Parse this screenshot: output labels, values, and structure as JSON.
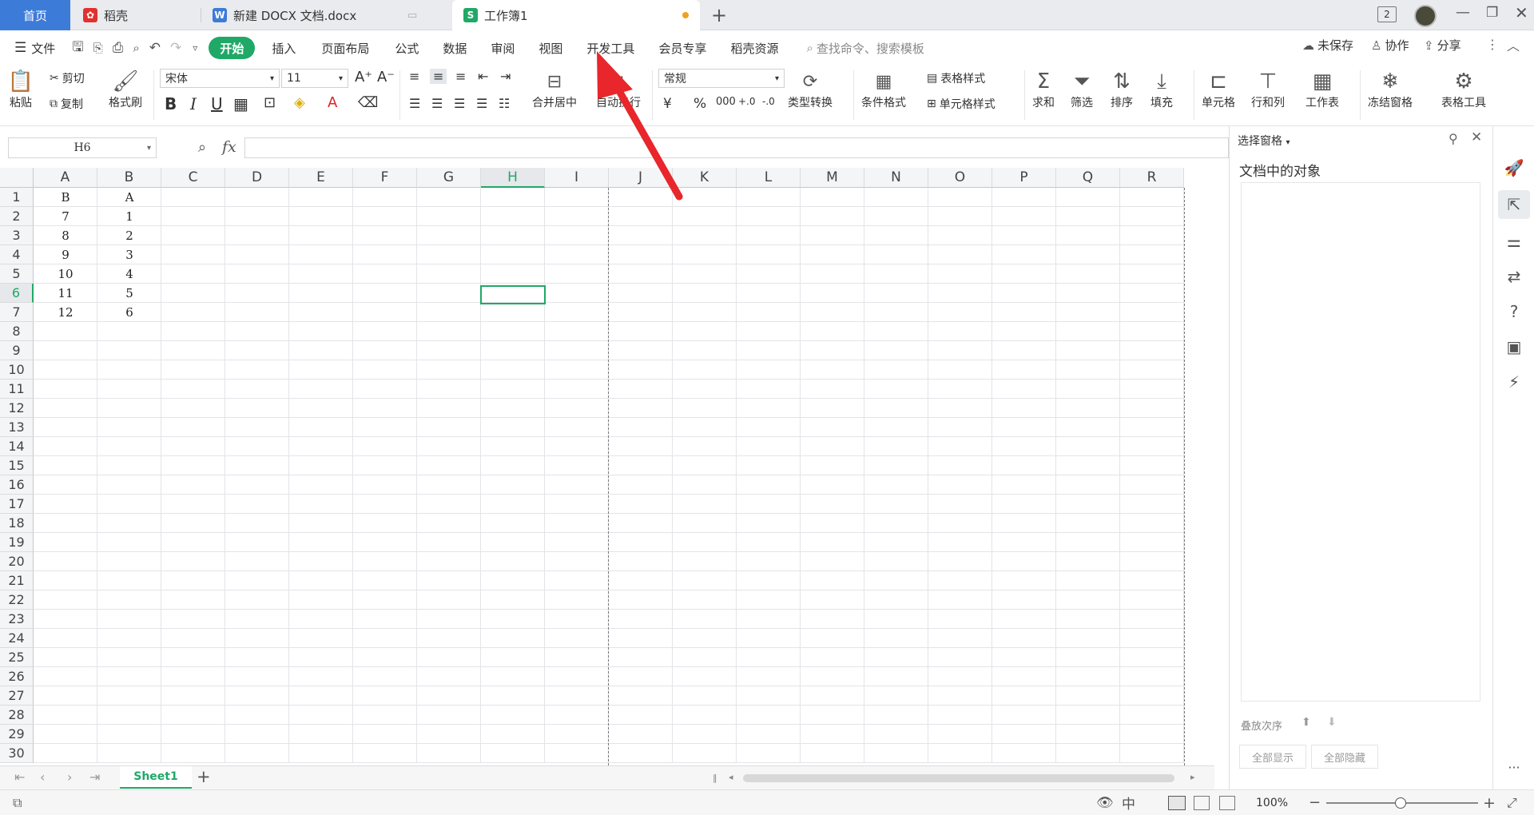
{
  "tabs": {
    "home": "首页",
    "daoke": "稻壳",
    "doc": "新建 DOCX 文档.docx",
    "book": "工作簿1",
    "badge": "2"
  },
  "menu": {
    "file": "文件",
    "items": [
      "开始",
      "插入",
      "页面布局",
      "公式",
      "数据",
      "审阅",
      "视图",
      "开发工具",
      "会员专享",
      "稻壳资源"
    ],
    "search_placeholder": "查找命令、搜索模板",
    "unsaved": "未保存",
    "collab": "协作",
    "share": "分享"
  },
  "ribbon": {
    "paste": "粘贴",
    "cut": "剪切",
    "copy": "复制",
    "format_painter": "格式刷",
    "font_name": "宋体",
    "font_size": "11",
    "merge_center": "合并居中",
    "wrap": "自动换行",
    "number_format": "常规",
    "type_convert": "类型转换",
    "cond_format": "条件格式",
    "table_style": "表格样式",
    "cell_style": "单元格样式",
    "sum": "求和",
    "filter": "筛选",
    "sort": "排序",
    "fill": "填充",
    "cell": "单元格",
    "row_col": "行和列",
    "worksheet": "工作表",
    "freeze": "冻结窗格",
    "table_tools": "表格工具",
    "bold": "B",
    "italic": "I",
    "underline": "U"
  },
  "formula": {
    "name_box": "H6",
    "fx": "fx"
  },
  "grid": {
    "columns": [
      "A",
      "B",
      "C",
      "D",
      "E",
      "F",
      "G",
      "H",
      "I",
      "J",
      "K",
      "L",
      "M",
      "N",
      "O",
      "P",
      "Q",
      "R"
    ],
    "active_column": "H",
    "active_row": "6",
    "rows": [
      "1",
      "2",
      "3",
      "4",
      "5",
      "6",
      "7",
      "8",
      "9",
      "10",
      "11",
      "12",
      "13",
      "14",
      "15",
      "16",
      "17",
      "18",
      "19",
      "20",
      "21",
      "22",
      "23",
      "24",
      "25",
      "26",
      "27",
      "28",
      "29",
      "30"
    ],
    "data": [
      [
        "B",
        "A"
      ],
      [
        "7",
        "1"
      ],
      [
        "8",
        "2"
      ],
      [
        "9",
        "3"
      ],
      [
        "10",
        "4"
      ],
      [
        "11",
        "5"
      ],
      [
        "12",
        "6"
      ]
    ]
  },
  "sheets": {
    "active": "Sheet1"
  },
  "status": {
    "zoom": "100%"
  },
  "pane": {
    "title": "选择窗格",
    "subtitle": "文档中的对象",
    "order": "叠放次序",
    "show_all": "全部显示",
    "hide_all": "全部隐藏"
  },
  "colors": {
    "accent": "#20a867",
    "home_tab": "#3d7bd9",
    "arrow": "#e8262b"
  }
}
